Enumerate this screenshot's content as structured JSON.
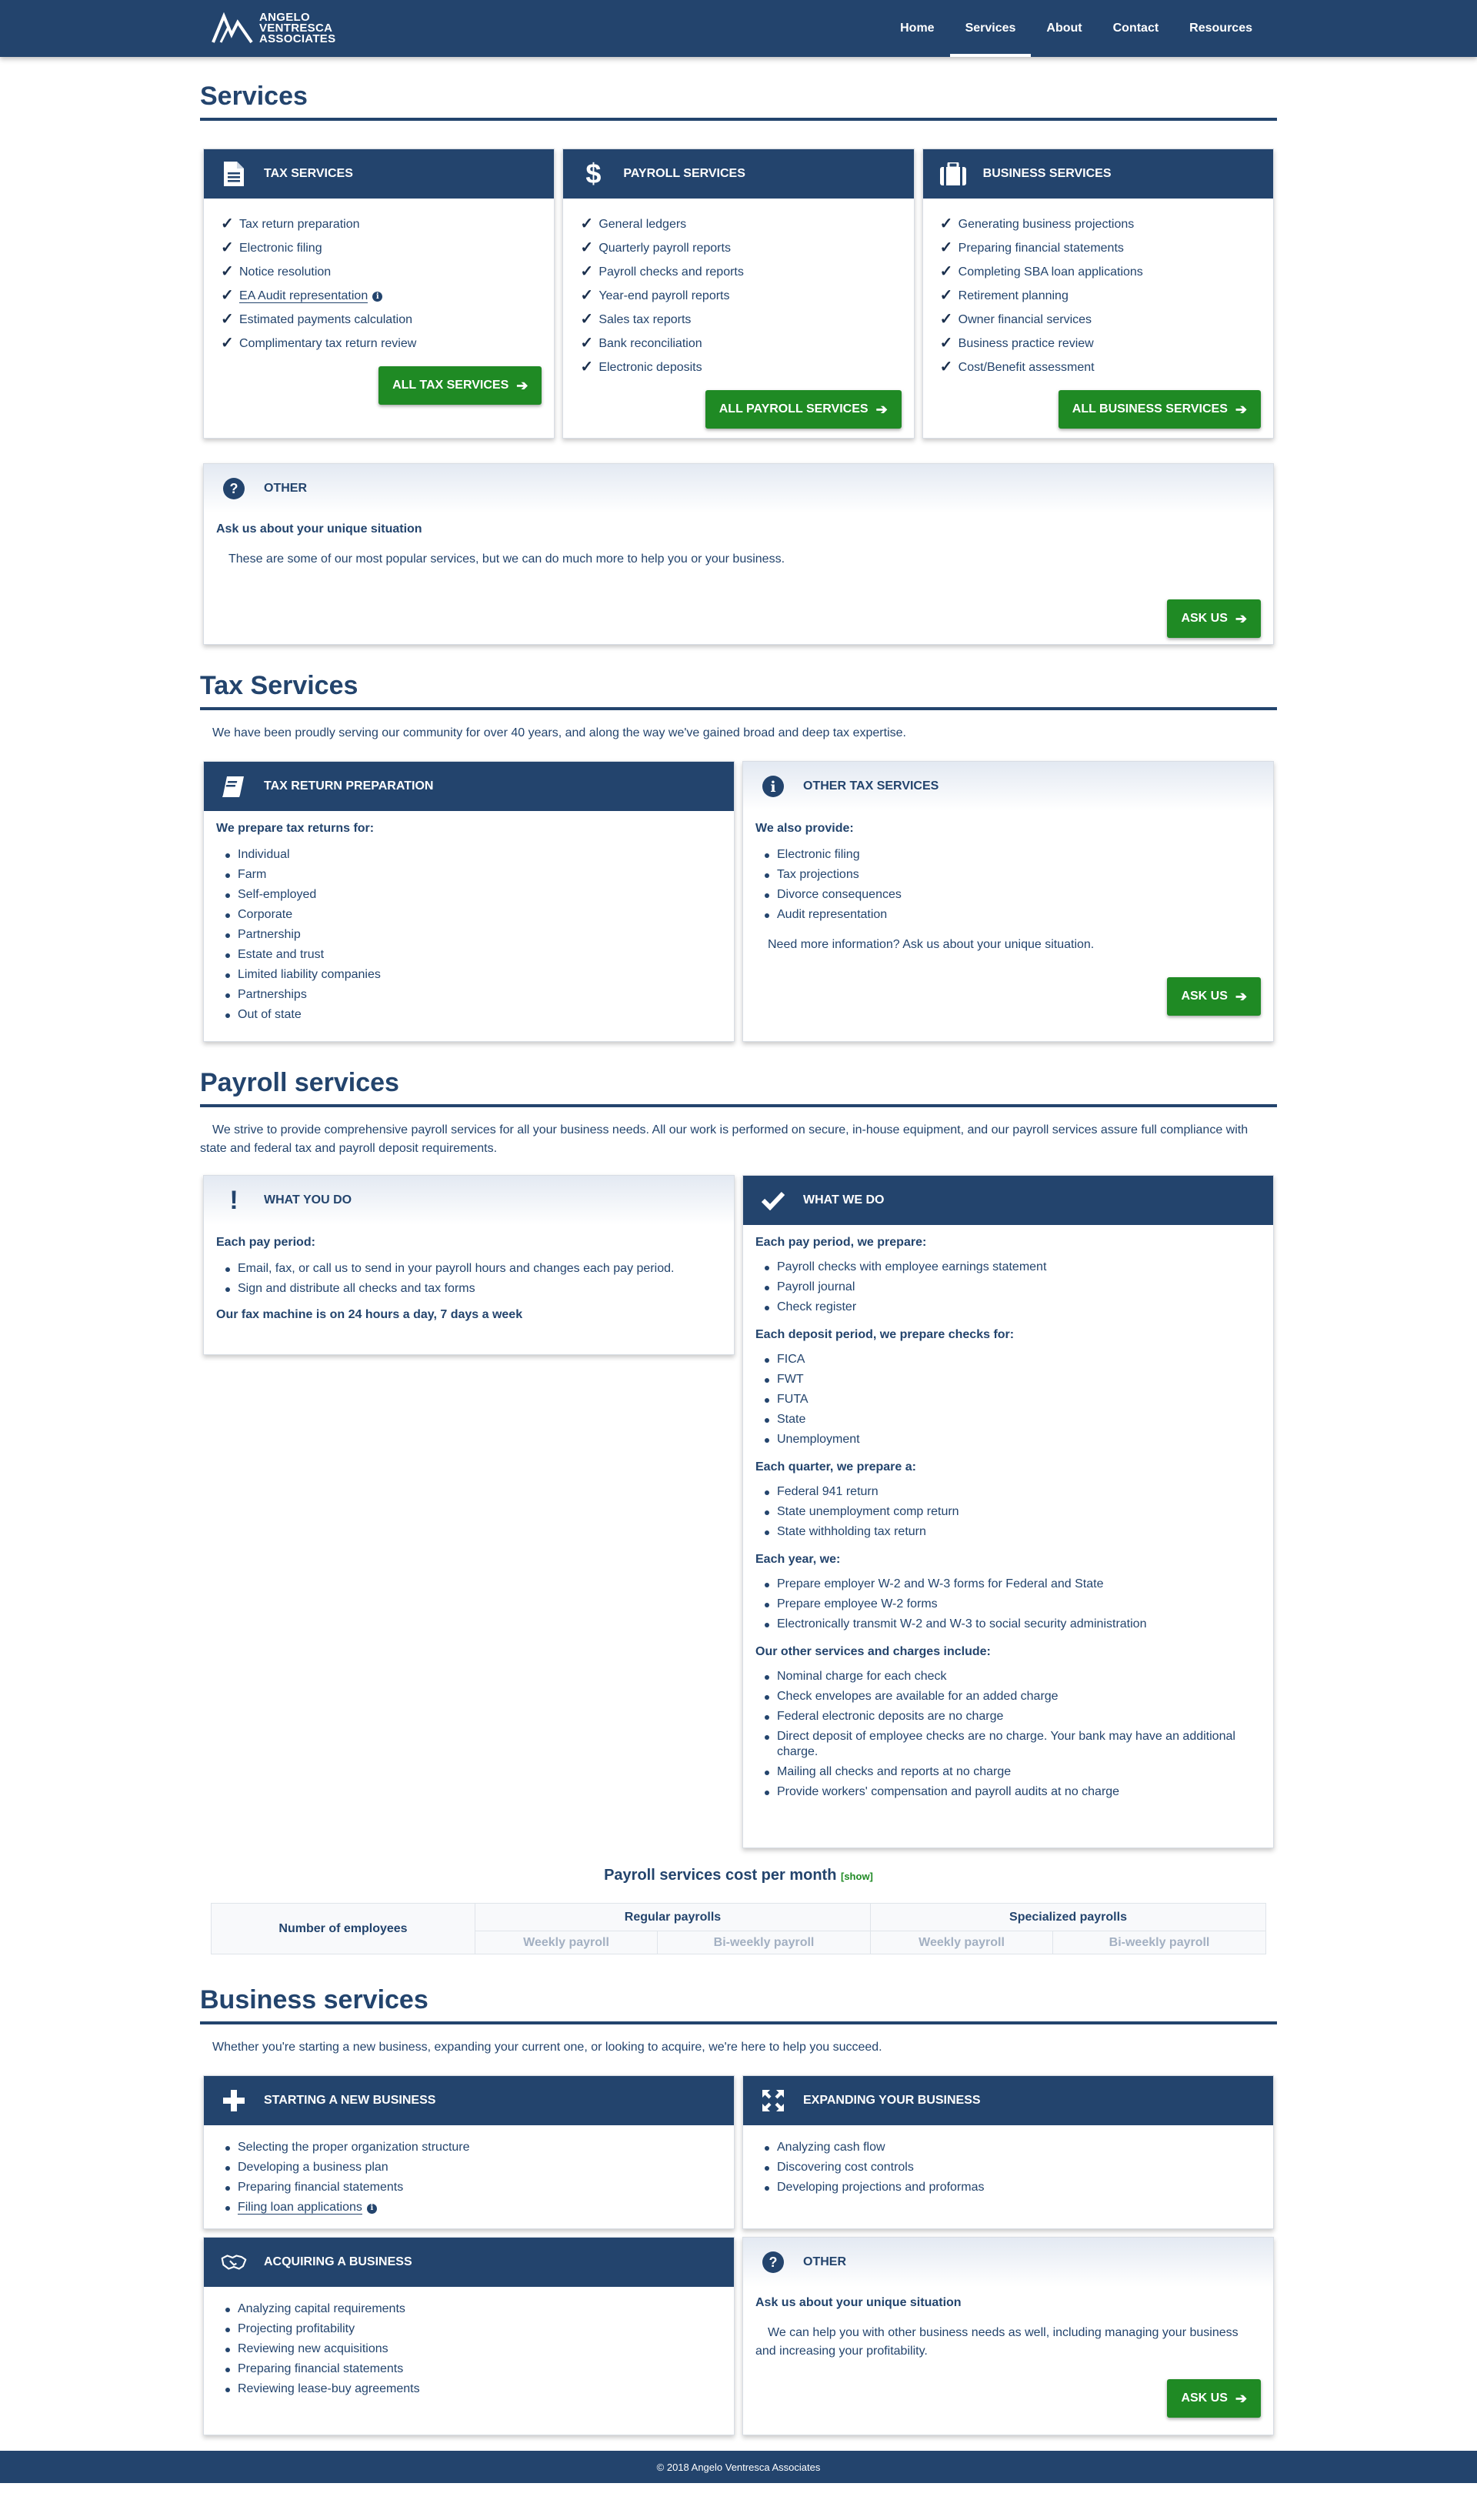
{
  "brand": {
    "line1": "ANGELO",
    "line2": "VENTRESCA",
    "line3": "ASSOCIATES"
  },
  "nav": [
    {
      "label": "Home"
    },
    {
      "label": "Services"
    },
    {
      "label": "About"
    },
    {
      "label": "Contact"
    },
    {
      "label": "Resources"
    }
  ],
  "services": {
    "title": "Services",
    "tax": {
      "header": "TAX SERVICES",
      "items": [
        "Tax return preparation",
        "Electronic filing",
        "Notice resolution",
        "EA Audit representation",
        "Estimated payments calculation",
        "Complimentary tax return review"
      ],
      "button": "ALL TAX SERVICES"
    },
    "payroll": {
      "header": "PAYROLL SERVICES",
      "items": [
        "General ledgers",
        "Quarterly payroll reports",
        "Payroll checks and reports",
        "Year-end payroll reports",
        "Sales tax reports",
        "Bank reconciliation",
        "Electronic deposits"
      ],
      "button": "ALL PAYROLL SERVICES"
    },
    "business": {
      "header": "BUSINESS SERVICES",
      "items": [
        "Generating business projections",
        "Preparing financial statements",
        "Completing SBA loan applications",
        "Retirement planning",
        "Owner financial services",
        "Business practice review",
        "Cost/Benefit assessment"
      ],
      "button": "ALL BUSINESS SERVICES"
    },
    "other": {
      "header": "OTHER",
      "subtitle": "Ask us about your unique situation",
      "text": "These are some of our most popular services, but we can do much more to help you or your business.",
      "button": "ASK US"
    }
  },
  "tax_services": {
    "title": "Tax Services",
    "intro": "We have been proudly serving our community for over 40 years, and along the way we've gained broad and deep tax expertise.",
    "prep": {
      "header": "TAX RETURN PREPARATION",
      "subtitle": "We prepare tax returns for:",
      "items": [
        "Individual",
        "Farm",
        "Self-employed",
        "Corporate",
        "Partnership",
        "Estate and trust",
        "Limited liability companies",
        "Partnerships",
        "Out of state"
      ]
    },
    "other": {
      "header": "OTHER TAX SERVICES",
      "subtitle": "We also provide:",
      "items": [
        "Electronic filing",
        "Tax projections",
        "Divorce consequences",
        "Audit representation"
      ],
      "note": "Need more information? Ask us about your unique situation.",
      "button": "ASK US"
    }
  },
  "payroll_services": {
    "title": "Payroll services",
    "intro": "We strive to provide comprehensive payroll services for all your business needs. All our work is performed on secure, in-house equipment, and our payroll services assure full compliance with state and federal tax and payroll deposit requirements.",
    "you": {
      "header": "WHAT YOU DO",
      "subtitle": "Each pay period:",
      "items": [
        "Email, fax, or call us to send in your payroll hours and changes each pay period.",
        "Sign and distribute all checks and tax forms"
      ],
      "note": "Our fax machine is on 24 hours a day, 7 days a week"
    },
    "we": {
      "header": "WHAT WE DO",
      "groups": [
        {
          "title": "Each pay period, we prepare:",
          "items": [
            "Payroll checks with employee earnings statement",
            "Payroll journal",
            "Check register"
          ]
        },
        {
          "title": "Each deposit period, we prepare checks for:",
          "items": [
            "FICA",
            "FWT",
            "FUTA",
            "State",
            "Unemployment"
          ]
        },
        {
          "title": "Each quarter, we prepare a:",
          "items": [
            "Federal 941 return",
            "State unemployment comp return",
            "State withholding tax return"
          ]
        },
        {
          "title": "Each year, we:",
          "items": [
            "Prepare employer W-2 and W-3 forms for Federal and State",
            "Prepare employee W-2 forms",
            "Electronically transmit W-2 and W-3 to social security administration"
          ]
        },
        {
          "title": "Our other services and charges include:",
          "items": [
            "Nominal charge for each check",
            "Check envelopes are available for an added charge",
            "Federal electronic deposits are no charge",
            "Direct deposit of employee checks are no charge. Your bank may have an additional charge.",
            "Mailing all checks and reports at no charge",
            "Provide workers' compensation and payroll audits at no charge"
          ]
        }
      ]
    },
    "cost": {
      "title": "Payroll services cost per month",
      "show": "[show]",
      "col_employees": "Number of employees",
      "col_regular": "Regular payrolls",
      "col_specialized": "Specialized payrolls",
      "sub": [
        "Weekly payroll",
        "Bi-weekly payroll",
        "Weekly payroll",
        "Bi-weekly payroll"
      ]
    }
  },
  "business_services": {
    "title": "Business services",
    "intro": "Whether you're starting a new business, expanding your current one, or looking to acquire, we're here to help you succeed.",
    "starting": {
      "header": "STARTING A NEW BUSINESS",
      "items": [
        "Selecting the proper organization structure",
        "Developing a business plan",
        "Preparing financial statements",
        "Filing loan applications"
      ]
    },
    "expanding": {
      "header": "EXPANDING YOUR BUSINESS",
      "items": [
        "Analyzing cash flow",
        "Discovering cost controls",
        "Developing projections and proformas"
      ]
    },
    "acquiring": {
      "header": "ACQUIRING A BUSINESS",
      "items": [
        "Analyzing capital requirements",
        "Projecting profitability",
        "Reviewing new acquisitions",
        "Preparing financial statements",
        "Reviewing lease-buy agreements"
      ]
    },
    "other": {
      "header": "OTHER",
      "subtitle": "Ask us about your unique situation",
      "text": "We can help you with other business needs as well, including managing your business and increasing your profitability.",
      "button": "ASK US"
    }
  },
  "footer": {
    "text": "© 2018 Angelo Ventresca Associates"
  },
  "colors": {
    "navy": "#23446d",
    "green": "#1f8a24"
  }
}
